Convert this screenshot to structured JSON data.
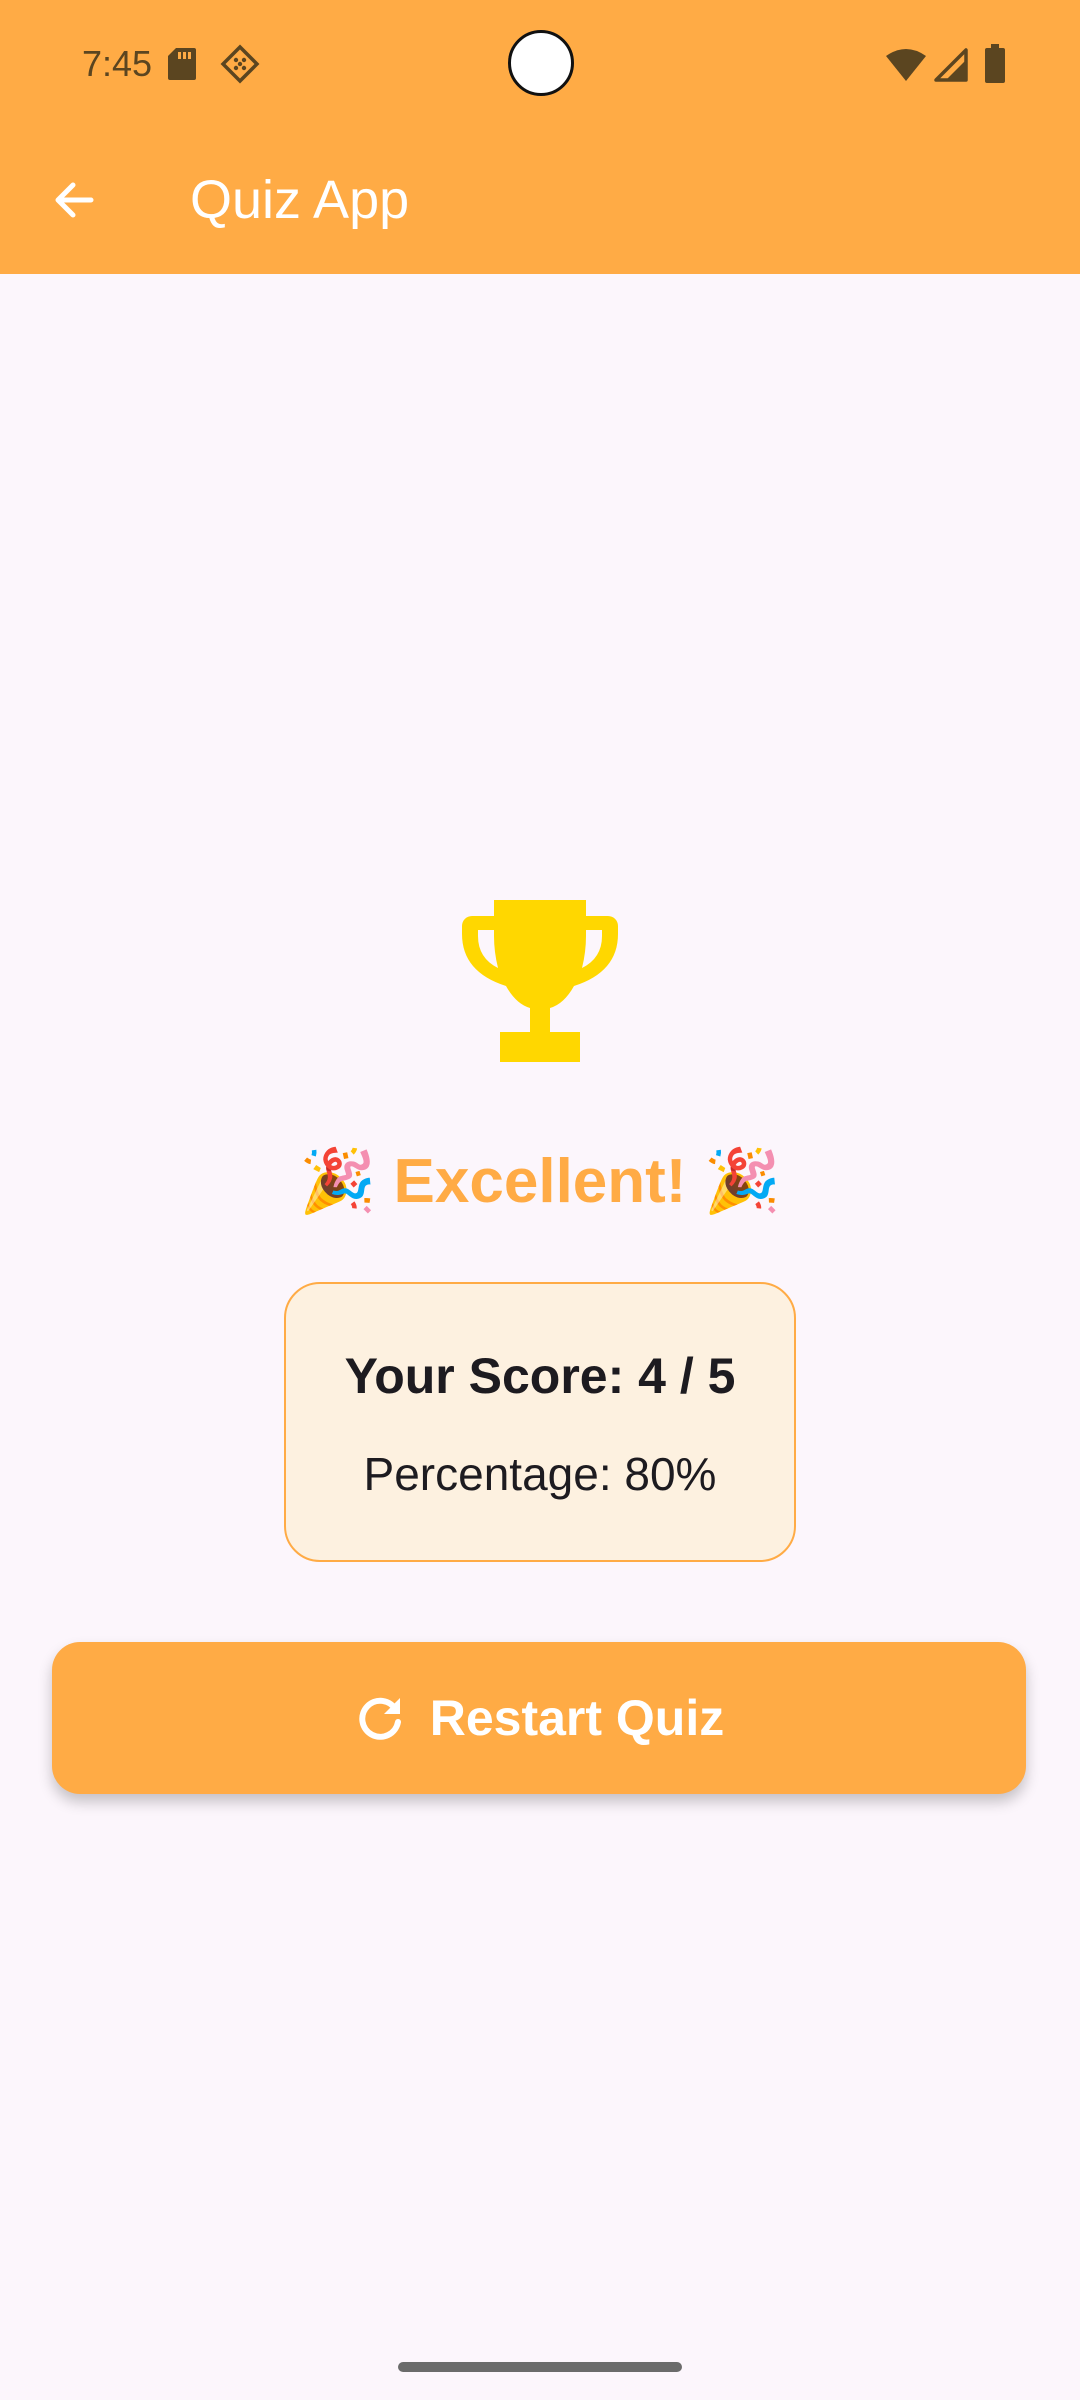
{
  "status_bar": {
    "time": "7:45",
    "icons": [
      "sd-card-icon",
      "app-notification-icon",
      "wifi-icon",
      "cell-signal-icon",
      "battery-icon"
    ]
  },
  "app_bar": {
    "title": "Quiz App",
    "back_icon": "arrow-back-icon"
  },
  "result": {
    "icon": "trophy-icon",
    "headline": "🎉 Excellent! 🎉",
    "score_text": "Your Score: 4 / 5",
    "percentage_text": "Percentage: 80%"
  },
  "actions": {
    "restart_label": "Restart Quiz",
    "restart_icon": "refresh-icon"
  },
  "colors": {
    "primary": "#ffab45",
    "trophy": "#ffd700",
    "background": "#fcf6fc",
    "card_background": "#fdf1e0",
    "text": "#1d1b20"
  }
}
